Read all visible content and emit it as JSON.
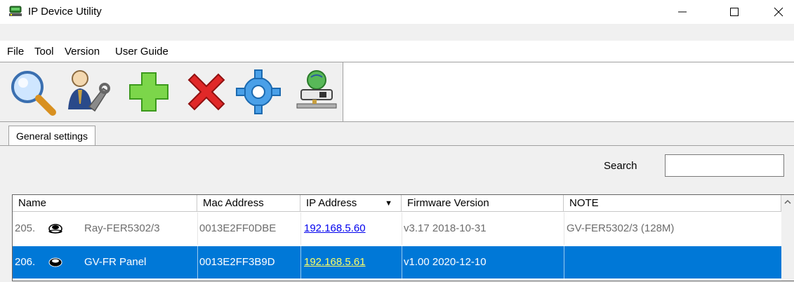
{
  "window": {
    "title": "IP Device Utility",
    "icon": "network-device-icon"
  },
  "menu": {
    "items": [
      "File",
      "Tool",
      "Version",
      "User Guide"
    ]
  },
  "toolbar": {
    "buttons": [
      "search-devices-icon",
      "user-settings-icon",
      "add-icon",
      "delete-icon",
      "gear-icon",
      "network-connection-icon"
    ]
  },
  "tabs": [
    "General settings"
  ],
  "search": {
    "label": "Search",
    "value": ""
  },
  "table": {
    "columns": [
      "Name",
      "Mac Address",
      "IP Address",
      "Firmware Version",
      "NOTE"
    ],
    "sort_indicator": "▼",
    "rows": [
      {
        "index": "205.",
        "name": "Ray-FER5302/3",
        "mac": "0013E2FF0DBE",
        "ip": "192.168.5.60",
        "firmware": "v3.17  2018-10-31",
        "note": "GV-FER5302/3 (128M)",
        "selected": false
      },
      {
        "index": "206.",
        "name": "GV-FR Panel",
        "mac": "0013E2FF3B9D",
        "ip": "192.168.5.61",
        "firmware": "v1.00  2020-12-10",
        "note": "",
        "selected": true
      }
    ]
  },
  "colors": {
    "selection": "#0078d7",
    "link": "#0000ee",
    "selected_link": "#ffff66"
  }
}
